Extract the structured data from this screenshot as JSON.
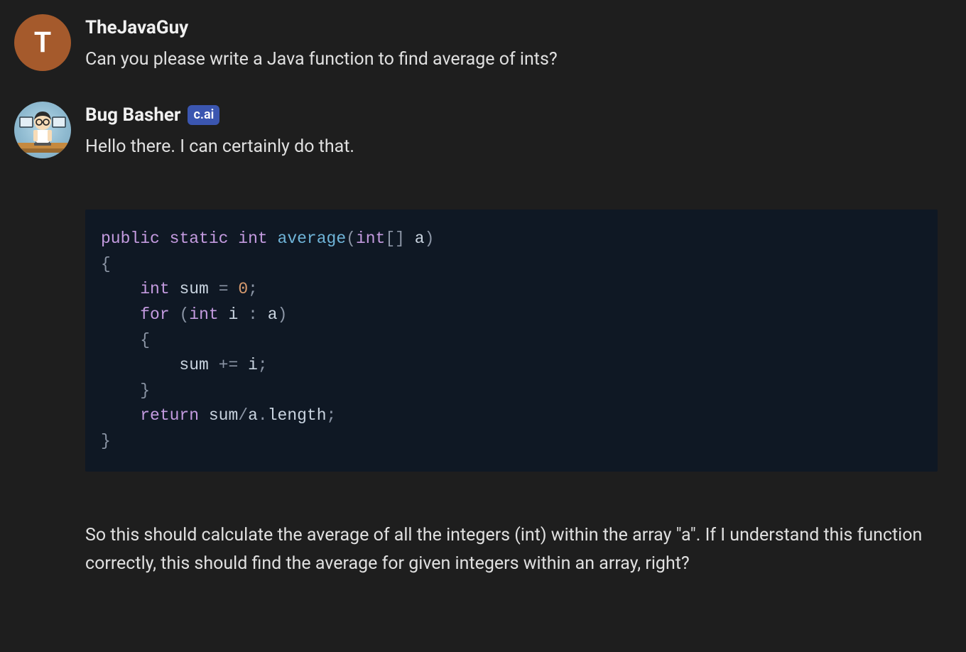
{
  "messages": [
    {
      "avatar_kind": "letter",
      "avatar_letter": "T",
      "username": "TheJavaGuy",
      "badge": null,
      "text": "Can you please write a Java function to find average of ints?"
    },
    {
      "avatar_kind": "bot",
      "username": "Bug Basher",
      "badge": "c.ai",
      "text": "Hello there. I can certainly do that.",
      "code": {
        "tokens": [
          {
            "t": "public",
            "c": "kw"
          },
          {
            "t": " ",
            "c": ""
          },
          {
            "t": "static",
            "c": "kw"
          },
          {
            "t": " ",
            "c": ""
          },
          {
            "t": "int",
            "c": "type"
          },
          {
            "t": " ",
            "c": ""
          },
          {
            "t": "average",
            "c": "fn"
          },
          {
            "t": "(",
            "c": "punc"
          },
          {
            "t": "int",
            "c": "type"
          },
          {
            "t": "[]",
            "c": "punc"
          },
          {
            "t": " ",
            "c": ""
          },
          {
            "t": "a",
            "c": "var"
          },
          {
            "t": ")",
            "c": "punc"
          },
          {
            "t": "\n",
            "c": ""
          },
          {
            "t": "{",
            "c": "punc"
          },
          {
            "t": "\n",
            "c": ""
          },
          {
            "t": "    ",
            "c": ""
          },
          {
            "t": "int",
            "c": "type"
          },
          {
            "t": " ",
            "c": ""
          },
          {
            "t": "sum",
            "c": "var"
          },
          {
            "t": " ",
            "c": ""
          },
          {
            "t": "=",
            "c": "punc"
          },
          {
            "t": " ",
            "c": ""
          },
          {
            "t": "0",
            "c": "num"
          },
          {
            "t": ";",
            "c": "punc"
          },
          {
            "t": "\n",
            "c": ""
          },
          {
            "t": "    ",
            "c": ""
          },
          {
            "t": "for",
            "c": "kw"
          },
          {
            "t": " ",
            "c": ""
          },
          {
            "t": "(",
            "c": "punc"
          },
          {
            "t": "int",
            "c": "type"
          },
          {
            "t": " ",
            "c": ""
          },
          {
            "t": "i",
            "c": "var"
          },
          {
            "t": " ",
            "c": ""
          },
          {
            "t": ":",
            "c": "punc"
          },
          {
            "t": " ",
            "c": ""
          },
          {
            "t": "a",
            "c": "var"
          },
          {
            "t": ")",
            "c": "punc"
          },
          {
            "t": "\n",
            "c": ""
          },
          {
            "t": "    ",
            "c": ""
          },
          {
            "t": "{",
            "c": "punc"
          },
          {
            "t": "\n",
            "c": ""
          },
          {
            "t": "        ",
            "c": ""
          },
          {
            "t": "sum",
            "c": "var"
          },
          {
            "t": " ",
            "c": ""
          },
          {
            "t": "+=",
            "c": "punc"
          },
          {
            "t": " ",
            "c": ""
          },
          {
            "t": "i",
            "c": "var"
          },
          {
            "t": ";",
            "c": "punc"
          },
          {
            "t": "\n",
            "c": ""
          },
          {
            "t": "    ",
            "c": ""
          },
          {
            "t": "}",
            "c": "punc"
          },
          {
            "t": "\n",
            "c": ""
          },
          {
            "t": "    ",
            "c": ""
          },
          {
            "t": "return",
            "c": "kw"
          },
          {
            "t": " ",
            "c": ""
          },
          {
            "t": "sum",
            "c": "var"
          },
          {
            "t": "/",
            "c": "punc"
          },
          {
            "t": "a",
            "c": "var"
          },
          {
            "t": ".",
            "c": "punc"
          },
          {
            "t": "length",
            "c": "var"
          },
          {
            "t": ";",
            "c": "punc"
          },
          {
            "t": "\n",
            "c": ""
          },
          {
            "t": "}",
            "c": "punc"
          }
        ]
      },
      "explain": "So this should calculate the average of all the integers (int) within the array \"a\". If I understand this function correctly, this should find the average for given integers within an array, right?"
    }
  ]
}
